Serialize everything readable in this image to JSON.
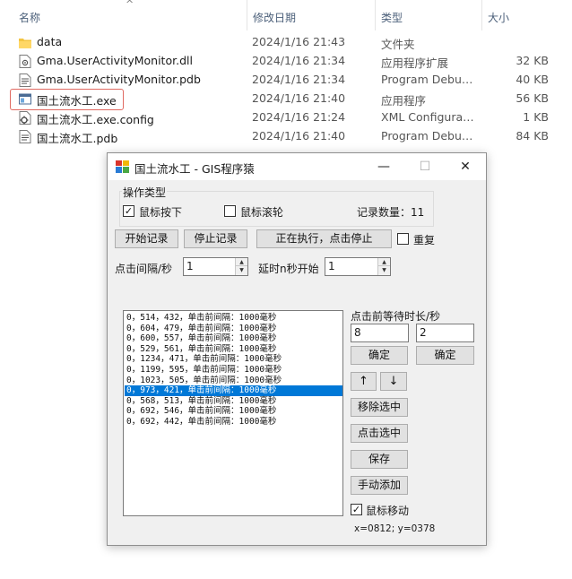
{
  "explorer": {
    "columns": {
      "name": "名称",
      "date": "修改日期",
      "type": "类型",
      "size": "大小"
    },
    "sort_indicator": "^",
    "files": [
      {
        "name": "data",
        "date": "2024/1/16 21:43",
        "type": "文件夹",
        "size": "",
        "icon": "folder-icon"
      },
      {
        "name": "Gma.UserActivityMonitor.dll",
        "date": "2024/1/16 21:34",
        "type": "应用程序扩展",
        "size": "32 KB",
        "icon": "dll-file-icon"
      },
      {
        "name": "Gma.UserActivityMonitor.pdb",
        "date": "2024/1/16 21:34",
        "type": "Program Debug...",
        "size": "40 KB",
        "icon": "pdb-file-icon"
      },
      {
        "name": "国土流水工.exe",
        "date": "2024/1/16 21:40",
        "type": "应用程序",
        "size": "56 KB",
        "icon": "exe-file-icon"
      },
      {
        "name": "国土流水工.exe.config",
        "date": "2024/1/16 21:24",
        "type": "XML Configurati...",
        "size": "1 KB",
        "icon": "config-file-icon"
      },
      {
        "name": "国土流水工.pdb",
        "date": "2024/1/16 21:40",
        "type": "Program Debug...",
        "size": "84 KB",
        "icon": "pdb-file-icon"
      }
    ]
  },
  "dialog": {
    "title": "国土流水工 - GIS程序猿",
    "titlebar_buttons": {
      "minimize": "—",
      "maximize": "☐",
      "close": "✕"
    },
    "group_title": "操作类型",
    "mouse_press_label": "鼠标按下",
    "mouse_press_checked": true,
    "mouse_wheel_label": "鼠标滚轮",
    "mouse_wheel_checked": false,
    "record_count_label": "记录数量：11",
    "start_record_label": "开始记录",
    "stop_record_label": "停止记录",
    "executing_label": "正在执行，点击停止",
    "repeat_label": "重复",
    "repeat_checked": false,
    "click_interval_label": "点击间隔/秒",
    "click_interval_value": "1",
    "delay_start_label": "延时n秒开始",
    "delay_start_value": "1",
    "list_items": [
      "0，514，432，单击前间隔：1000毫秒",
      "0，604，479，单击前间隔：1000毫秒",
      "0，600，557，单击前间隔：1000毫秒",
      "0，529，561，单击前间隔：1000毫秒",
      "0，1234，471，单击前间隔：1000毫秒",
      "0，1199，595，单击前间隔：1000毫秒",
      "0，1023，505，单击前间隔：1000毫秒",
      "0，973，421，单击前间隔：1000毫秒",
      "0，568，513，单击前间隔：1000毫秒",
      "0，692，546，单击前间隔：1000毫秒",
      "0，692，442，单击前间隔：1000毫秒"
    ],
    "selected_index": 7,
    "wait_label": "点击前等待时长/秒",
    "wait_value_1": "8",
    "wait_value_2": "2",
    "confirm_label": "确定",
    "up_arrow": "↑",
    "down_arrow": "↓",
    "remove_selected_label": "移除选中",
    "click_selected_label": "点击选中",
    "save_label": "保存",
    "manual_add_label": "手动添加",
    "mouse_move_label": "鼠标移动",
    "mouse_move_checked": true,
    "coords_text": "x=0812; y=0378"
  },
  "colors": {
    "selection": "#0078d7",
    "highlight_outline": "#e06a62",
    "folder": "#f4c542"
  }
}
